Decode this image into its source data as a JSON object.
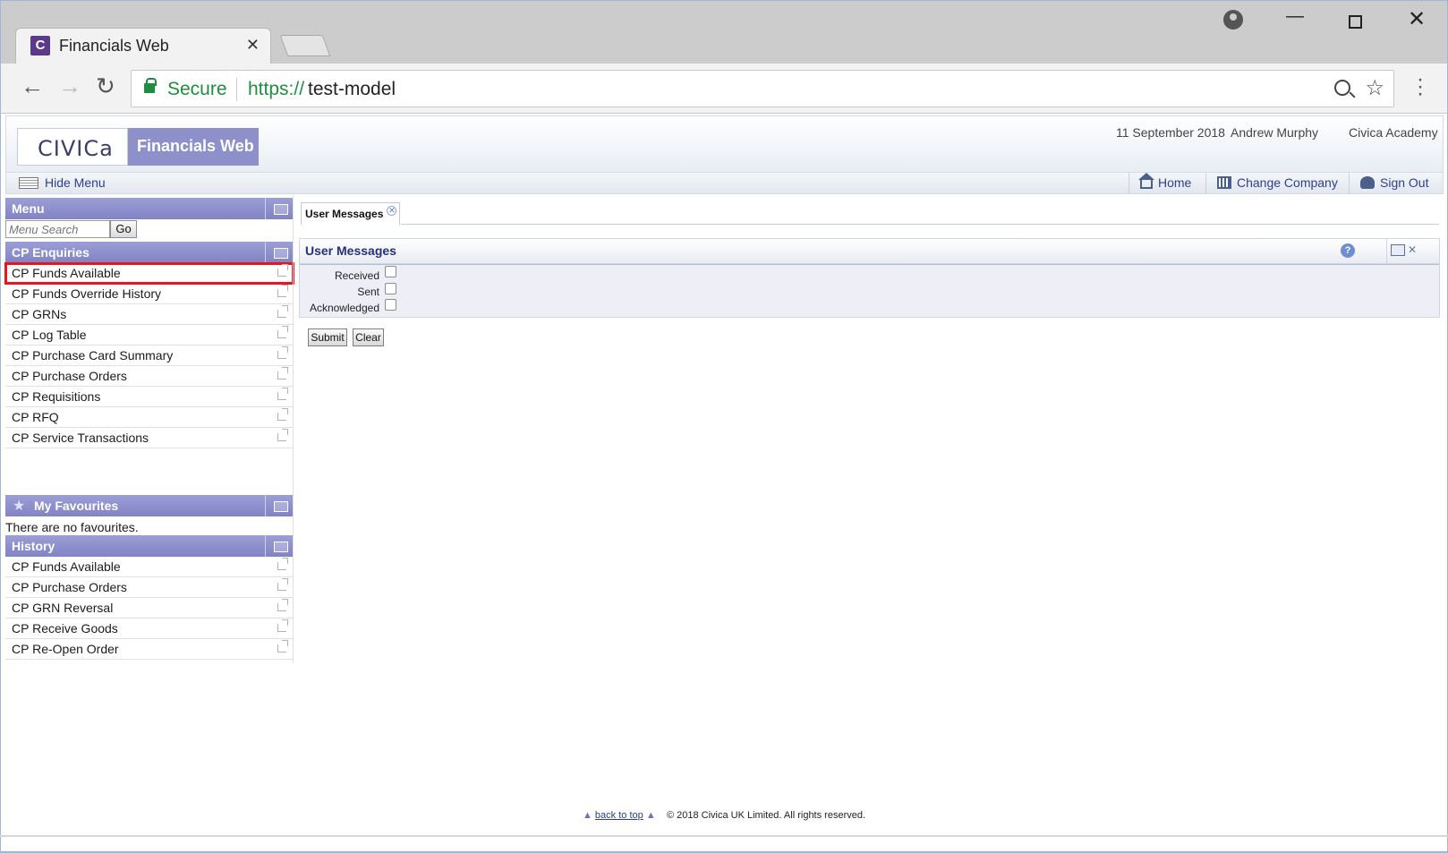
{
  "browser": {
    "tab_title": "Financials Web",
    "tab_favicon_letter": "C",
    "secure_label": "Secure",
    "url_scheme": "https://",
    "url_host": "test-model"
  },
  "header": {
    "logo": "CIVICa",
    "product": "Financials Web",
    "date": "11 September 2018",
    "user": "Andrew Murphy",
    "company": "Civica Academy"
  },
  "subnav": {
    "hide_menu": "Hide Menu",
    "home": "Home",
    "change_company": "Change Company",
    "sign_out": "Sign Out"
  },
  "menu": {
    "title": "Menu",
    "search_placeholder": "Menu Search",
    "go_label": "Go"
  },
  "enquiries": {
    "title": "CP Enquiries",
    "items": [
      "CP Funds Available",
      "CP Funds Override History",
      "CP GRNs",
      "CP Log Table",
      "CP Purchase Card Summary",
      "CP Purchase Orders",
      "CP Requisitions",
      "CP RFQ",
      "CP Service Transactions"
    ]
  },
  "favourites": {
    "title": "My Favourites",
    "empty_text": "There are no favourites."
  },
  "history": {
    "title": "History",
    "items": [
      "CP Funds Available",
      "CP Purchase Orders",
      "CP GRN Reversal",
      "CP Receive Goods",
      "CP Re-Open Order"
    ]
  },
  "content": {
    "tab_label": "User Messages",
    "box_title": "User Messages",
    "fields": {
      "received": "Received",
      "sent": "Sent",
      "acknowledged": "Acknowledged"
    },
    "submit_label": "Submit",
    "clear_label": "Clear"
  },
  "footer": {
    "back_to_top": "back to top",
    "copyright": "© 2018 Civica UK Limited. All rights reserved."
  },
  "colors": {
    "panel_header": "#8183c4",
    "highlight_outline": "#e8141e",
    "secure_green": "#1e8e3e",
    "title_navy": "#24307a"
  }
}
